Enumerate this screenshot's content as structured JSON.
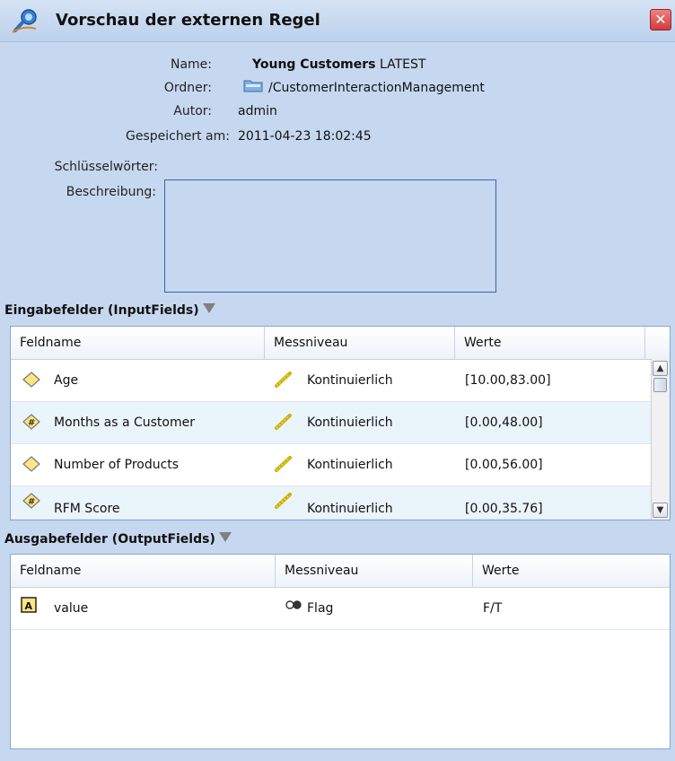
{
  "window": {
    "title": "Vorschau der externen Regel",
    "close_glyph": "✕"
  },
  "properties": {
    "name_label": "Name:",
    "name_value": "Young Customers",
    "name_version": "LATEST",
    "folder_label": "Ordner:",
    "folder_value": "/CustomerInteractionManagement",
    "author_label": "Autor:",
    "author_value": "admin",
    "saved_label": "Gespeichert am:",
    "saved_value": "2011-04-23 18:02:45",
    "keywords_label": "Schlüsselwörter:",
    "keywords_value": "",
    "description_label": "Beschreibung:",
    "description_value": ""
  },
  "input_fields": {
    "title": "Eingabefelder (InputFields)",
    "columns": [
      "Feldname",
      "Messniveau",
      "Werte"
    ],
    "rows": [
      {
        "name": "Age",
        "icon": "diamond-field-icon",
        "level": "Kontinuierlich",
        "values": "[10.00,83.00]"
      },
      {
        "name": "Months as a Customer",
        "icon": "numeric-field-icon",
        "level": "Kontinuierlich",
        "values": "[0.00,48.00]"
      },
      {
        "name": "Number of Products",
        "icon": "diamond-field-icon",
        "level": "Kontinuierlich",
        "values": "[0.00,56.00]"
      },
      {
        "name": "RFM Score",
        "icon": "numeric-field-icon",
        "level": "Kontinuierlich",
        "values": "[0.00,35.76]"
      }
    ]
  },
  "output_fields": {
    "title": "Ausgabefelder (OutputFields)",
    "columns": [
      "Feldname",
      "Messniveau",
      "Werte"
    ],
    "rows": [
      {
        "name": "value",
        "icon": "string-field-icon",
        "level": "Flag",
        "values": "F/T"
      }
    ]
  },
  "colors": {
    "background": "#c6d8ef",
    "row_alt": "#eaf4fb",
    "border": "#8aa6cb"
  }
}
